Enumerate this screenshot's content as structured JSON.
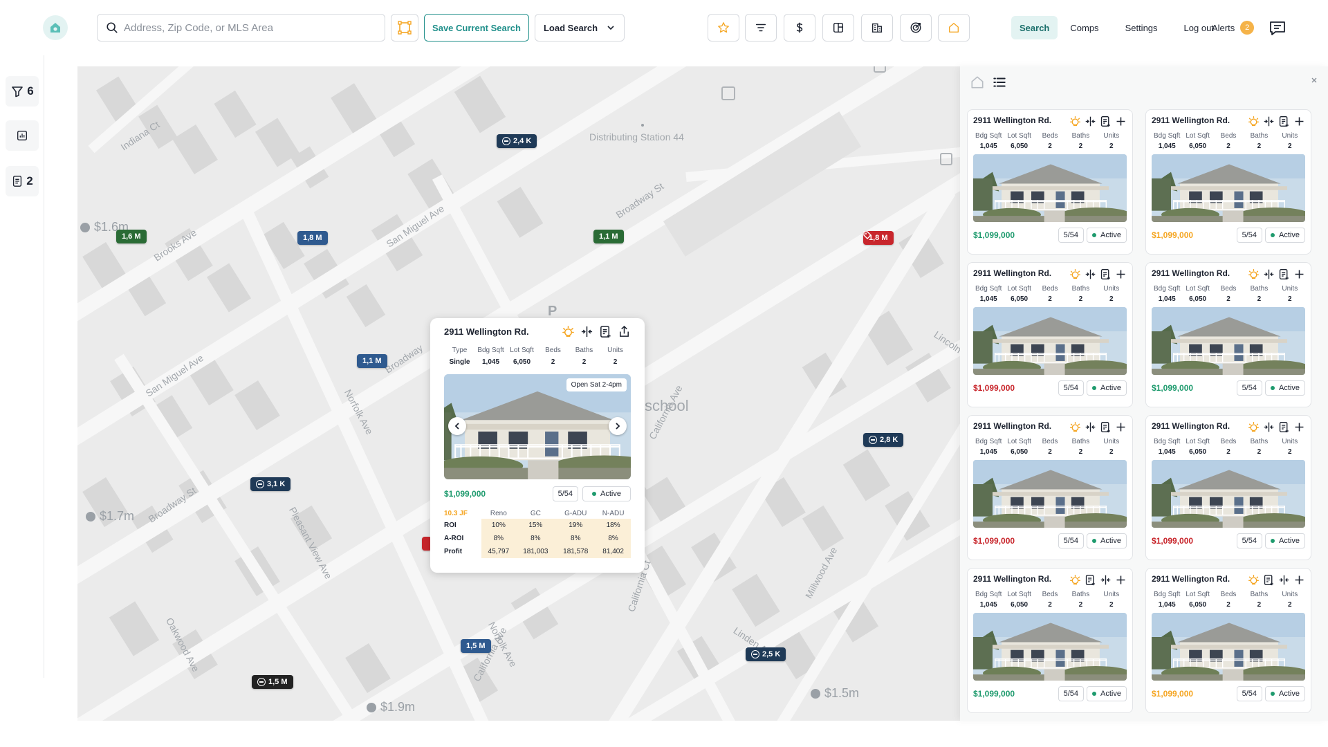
{
  "search": {
    "placeholder": "Address, Zip Code, or MLS Area",
    "value": ""
  },
  "toolbar": {
    "save_label": "Save Current Search",
    "load_label": "Load Search"
  },
  "nav": {
    "search": "Search",
    "comps": "Comps",
    "settings": "Settings",
    "logout": "Log out",
    "alerts": "Alerts",
    "alerts_count": "2"
  },
  "rail": {
    "filters_count": "6",
    "notes_count": "2"
  },
  "map": {
    "pins": [
      {
        "label": "2,4 K",
        "kind": "navy",
        "cluster": true
      },
      {
        "label": "1,6 M",
        "kind": "green",
        "cluster": false
      },
      {
        "label": "1,8 M",
        "kind": "blue",
        "cluster": false
      },
      {
        "label": "1,1 M",
        "kind": "green",
        "cluster": false
      },
      {
        "label": "1,8 M",
        "kind": "red",
        "cluster": false
      },
      {
        "label": "1,1 M",
        "kind": "blue",
        "cluster": false
      },
      {
        "label": "2,8 K",
        "kind": "navy",
        "cluster": true
      },
      {
        "label": "3,1 K",
        "kind": "navy",
        "cluster": true
      },
      {
        "label": "1,5 M",
        "kind": "blue",
        "cluster": false
      },
      {
        "label": "2,5 K",
        "kind": "navy",
        "cluster": true
      },
      {
        "label": "1,5 M",
        "kind": "dark",
        "cluster": true
      }
    ],
    "ghost_prices": [
      "$1.6m",
      "$1.7m",
      "$1.9m",
      "$1.5m"
    ],
    "labels": {
      "poi": "Distributing Station 44",
      "school": "school",
      "streets": [
        "Indiana Ct",
        "Brooks Ave",
        "San Miguel Ave",
        "Broadway St",
        "San Miguel Ave",
        "Broadway",
        "Norfolk Ave",
        "Broadway St",
        "Pleasant View Ave",
        "Oakwood Ave",
        "Norfolk Ave",
        "California Ave",
        "California Ave",
        "California Ct",
        "Linden Ave",
        "Millwood Ave",
        "Lincoln"
      ]
    }
  },
  "popup": {
    "title": "2911 Wellington Rd.",
    "specs": [
      {
        "label": "Type",
        "value": "Single"
      },
      {
        "label": "Bdg Sqft",
        "value": "1,045"
      },
      {
        "label": "Lot Sqft",
        "value": "6,050"
      },
      {
        "label": "Beds",
        "value": "2"
      },
      {
        "label": "Baths",
        "value": "2"
      },
      {
        "label": "Units",
        "value": "2"
      }
    ],
    "open_house": "Open Sat 2-4pm",
    "price": "$1,099,000",
    "photo_count": "5/54",
    "status": "Active",
    "roi_table": {
      "corner": "10.3 JF",
      "columns": [
        "Reno",
        "GC",
        "G-ADU",
        "N-ADU"
      ],
      "rows": [
        {
          "label": "ROI",
          "values": [
            "10%",
            "15%",
            "19%",
            "18%"
          ]
        },
        {
          "label": "A-ROI",
          "values": [
            "8%",
            "8%",
            "8%",
            "8%"
          ]
        },
        {
          "label": "Profit",
          "values": [
            "45,797",
            "181,003",
            "181,578",
            "81,402"
          ]
        }
      ]
    }
  },
  "listings": {
    "spec_labels": [
      "Bdg Sqft",
      "Lot Sqft",
      "Beds",
      "Baths",
      "Units"
    ],
    "cards": [
      {
        "title": "2911 Wellington Rd.",
        "specs": [
          "1,045",
          "6,050",
          "2",
          "2",
          "2"
        ],
        "price": "$1,099,000",
        "price_color": "teal",
        "photo_count": "5/54",
        "status": "Active"
      },
      {
        "title": "2911 Wellington Rd.",
        "specs": [
          "1,045",
          "6,050",
          "2",
          "2",
          "2"
        ],
        "price": "$1,099,000",
        "price_color": "orange",
        "photo_count": "5/54",
        "status": "Active"
      },
      {
        "title": "2911 Wellington Rd.",
        "specs": [
          "1,045",
          "6,050",
          "2",
          "2",
          "2"
        ],
        "price": "$1,099,000",
        "price_color": "red",
        "photo_count": "5/54",
        "status": "Active"
      },
      {
        "title": "2911 Wellington Rd.",
        "specs": [
          "1,045",
          "6,050",
          "2",
          "2",
          "2"
        ],
        "price": "$1,099,000",
        "price_color": "teal",
        "photo_count": "5/54",
        "status": "Active"
      },
      {
        "title": "2911 Wellington Rd.",
        "specs": [
          "1,045",
          "6,050",
          "2",
          "2",
          "2"
        ],
        "price": "$1,099,000",
        "price_color": "red",
        "photo_count": "5/54",
        "status": "Active"
      },
      {
        "title": "2911 Wellington Rd.",
        "specs": [
          "1,045",
          "6,050",
          "2",
          "2",
          "2"
        ],
        "price": "$1,099,000",
        "price_color": "red",
        "photo_count": "5/54",
        "status": "Active"
      },
      {
        "title": "2911 Wellington Rd.",
        "specs": [
          "1,045",
          "6,050",
          "2",
          "2",
          "2"
        ],
        "price": "$1,099,000",
        "price_color": "teal",
        "photo_count": "5/54",
        "status": "Active"
      },
      {
        "title": "2911 Wellington Rd.",
        "specs": [
          "1,045",
          "6,050",
          "2",
          "2",
          "2"
        ],
        "price": "$1,099,000",
        "price_color": "orange",
        "photo_count": "5/54",
        "status": "Active"
      }
    ]
  },
  "colors": {
    "accent": "#1f8f8a",
    "price_teal": "#1f9b6e",
    "price_orange": "#f5a623",
    "price_red": "#c8262c",
    "roi_fill": "#fbefd7"
  }
}
